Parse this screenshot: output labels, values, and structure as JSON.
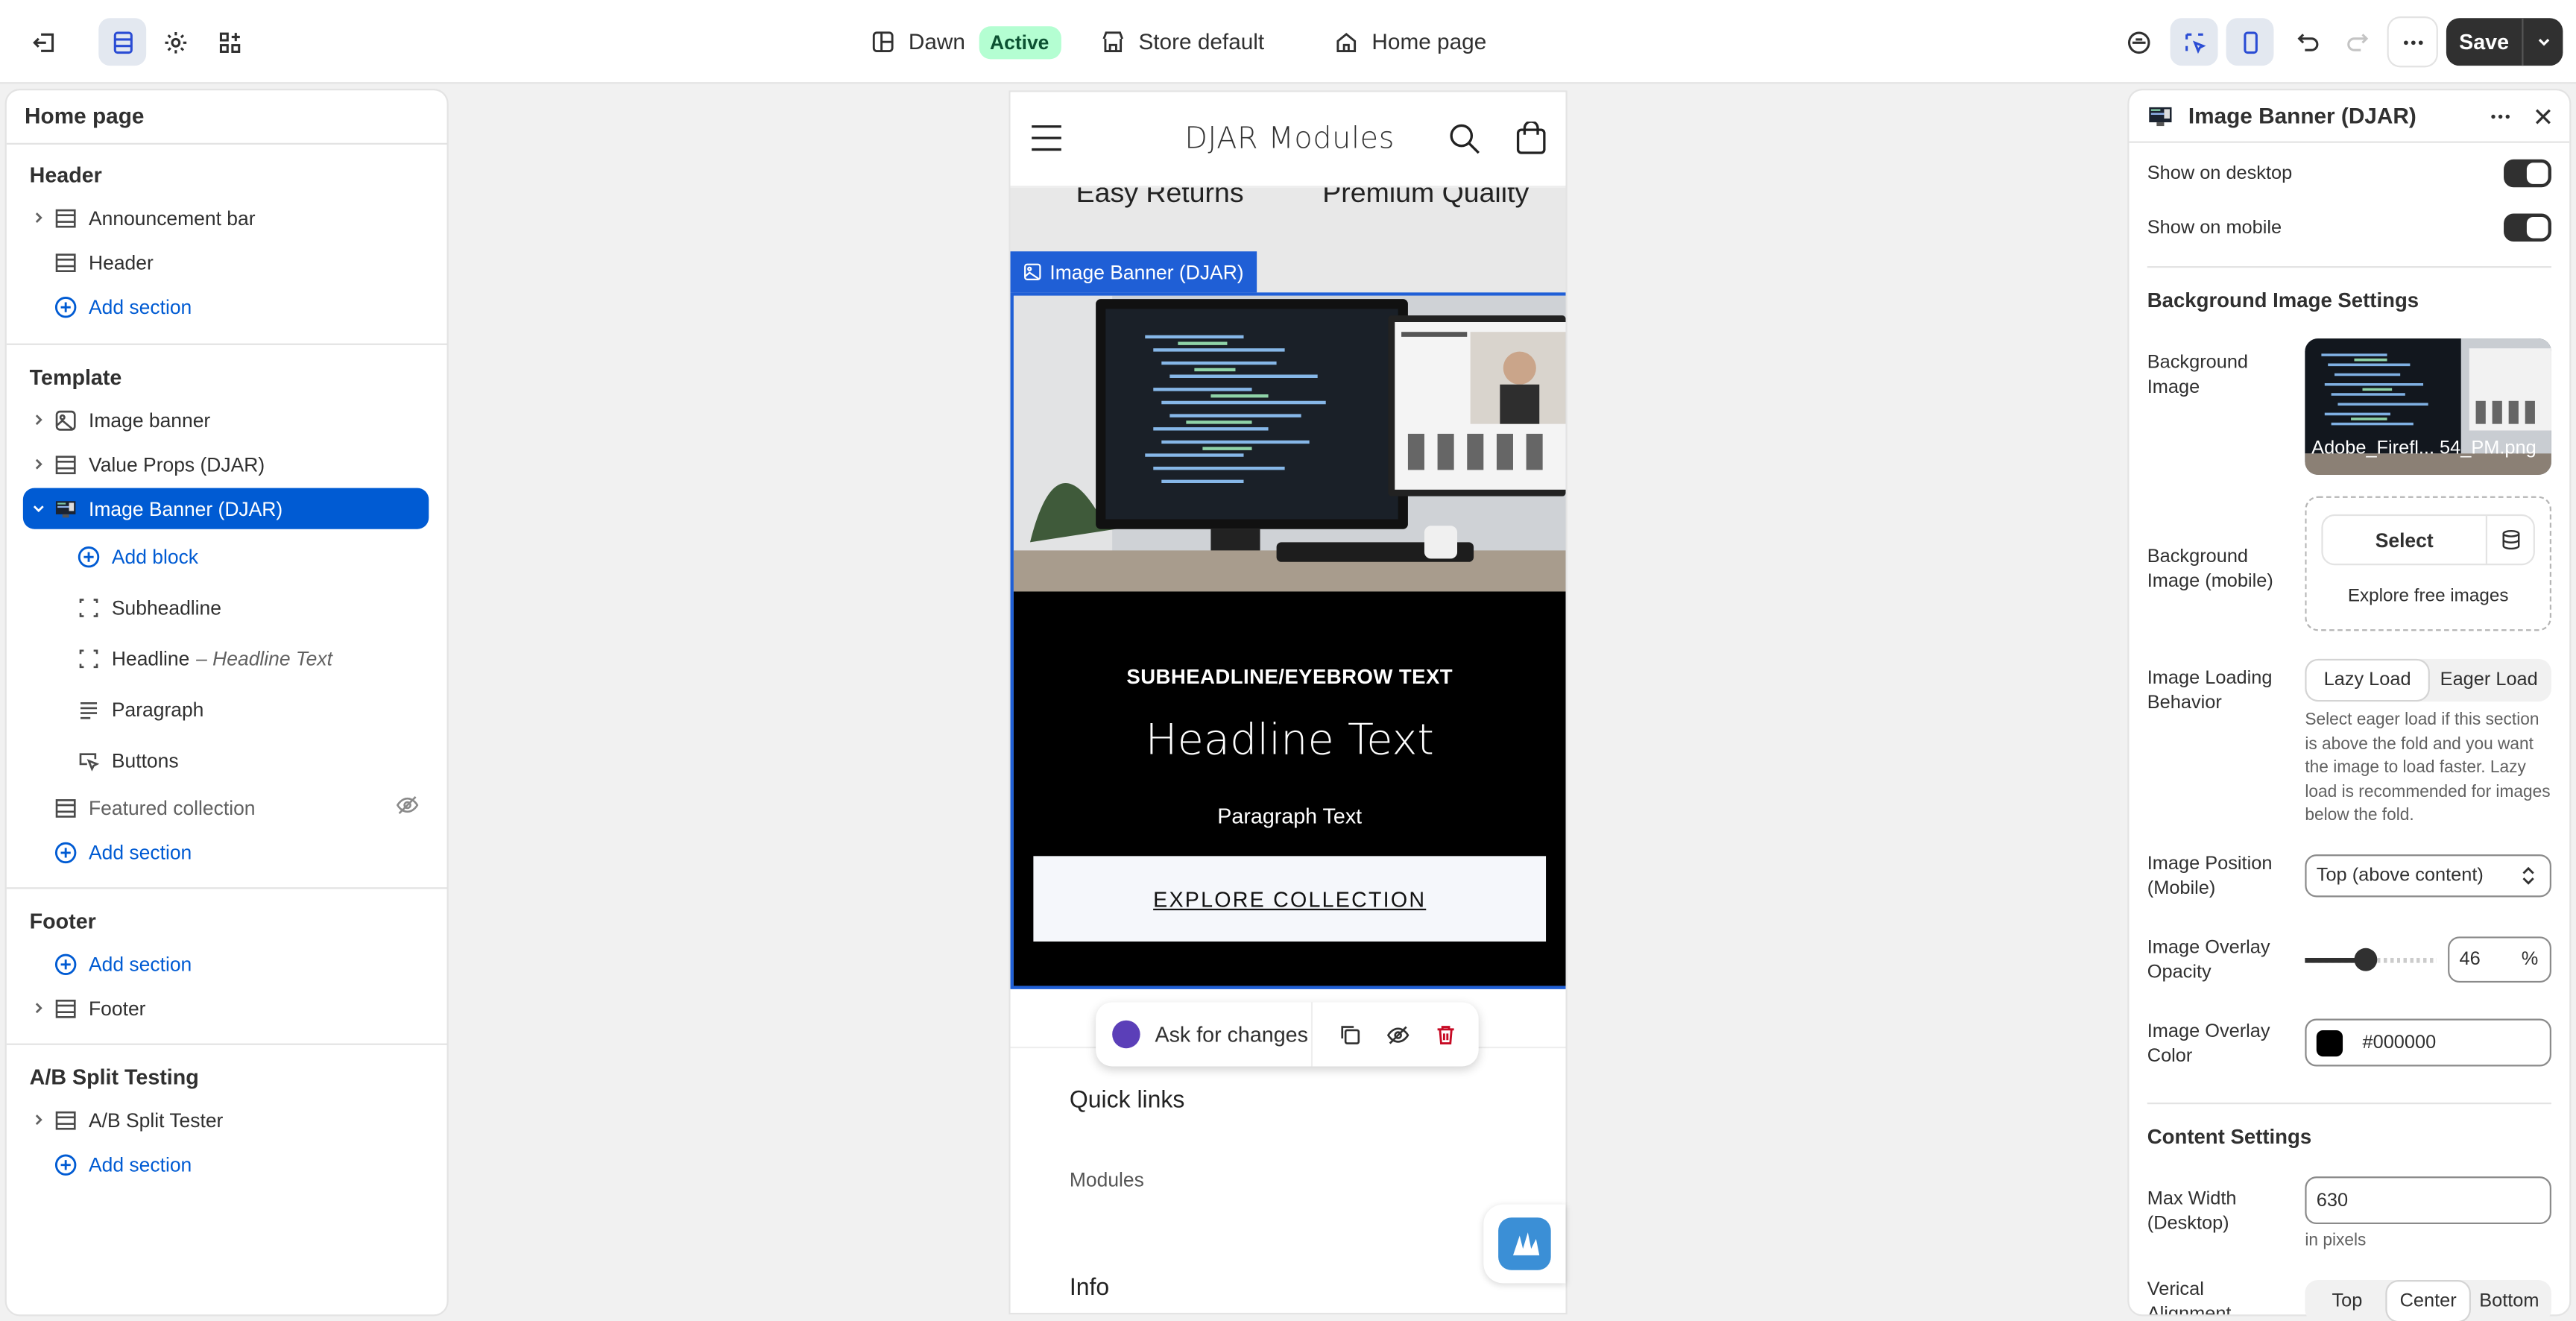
{
  "topbar": {
    "theme_name": "Dawn",
    "theme_status": "Active",
    "store": "Store default",
    "page": "Home page",
    "save_label": "Save"
  },
  "left": {
    "title": "Home page",
    "header_group": "Header",
    "template_group": "Template",
    "footer_group": "Footer",
    "ab_group": "A/B Split Testing",
    "header_items": [
      "Announcement bar",
      "Header"
    ],
    "add_section": "Add section",
    "add_block": "Add block",
    "template_items": [
      "Image banner",
      "Value Props (DJAR)",
      "Image Banner (DJAR)"
    ],
    "blocks": [
      "Subheadline",
      "Headline",
      "Paragraph",
      "Buttons"
    ],
    "headline_detail": "– Headline Text",
    "featured": "Featured collection",
    "footer_items": [
      "Footer"
    ],
    "ab_items": [
      "A/B Split Tester"
    ]
  },
  "preview": {
    "store_title": "DJAR Modules",
    "prop_left": "Easy Returns",
    "prop_right": "Premium Quality",
    "section_label": "Image Banner (DJAR)",
    "eyebrow": "SUBHEADLINE/EYEBROW TEXT",
    "headline": "Headline Text",
    "paragraph": "Paragraph Text",
    "cta": "EXPLORE COLLECTION",
    "ask": "Ask for changes",
    "footer_quick": "Quick links",
    "footer_modules": "Modules",
    "footer_info": "Info"
  },
  "right": {
    "title": "Image Banner (DJAR)",
    "show_desktop": "Show on desktop",
    "show_mobile": "Show on mobile",
    "bg_settings": "Background Image Settings",
    "bg_image": "Background Image",
    "bg_image_file": "Adobe_Firefl... 54_PM.png",
    "bg_image_mobile": "Background Image (mobile)",
    "select": "Select",
    "explore": "Explore free images",
    "loading_label": "Image Loading Behavior",
    "lazy": "Lazy Load",
    "eager": "Eager Load",
    "loading_help": "Select eager load if this section is above the fold and you want the image to load faster. Lazy load is recommended for images below the fold.",
    "position_label": "Image Position (Mobile)",
    "position_value": "Top (above content)",
    "opacity_label": "Image Overlay Opacity",
    "opacity_value": "46",
    "opacity_unit": "%",
    "color_label": "Image Overlay Color",
    "color_value": "#000000",
    "content_settings": "Content Settings",
    "maxwidth_label": "Max Width (Desktop)",
    "maxwidth_value": "630",
    "maxwidth_help": "in pixels",
    "valign_label": "Verical Alignment",
    "valign_options": [
      "Top",
      "Center",
      "Bottom"
    ]
  },
  "colors": {
    "accent": "#005bd3",
    "selection": "#1f5fd6",
    "active_badge": "#b4fed2",
    "save_bg": "#303030",
    "overlay": "#000000"
  },
  "opacity_fraction": 0.46
}
